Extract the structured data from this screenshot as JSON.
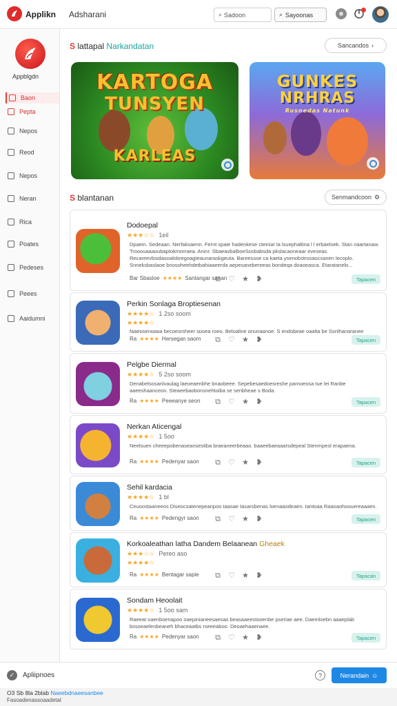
{
  "header": {
    "brand": "Applikn",
    "title": "Adsharani",
    "search_label": "Sadoon",
    "button_label": "Sayoonas"
  },
  "sidebar": {
    "brand": "Appblgdn",
    "items": [
      {
        "label": "Baon",
        "icon": "home-icon",
        "state": "active"
      },
      {
        "label": "Pepta",
        "icon": "star-icon",
        "state": "red"
      },
      {
        "label": "Nepos",
        "icon": "grid-icon",
        "state": ""
      },
      {
        "label": "Reod",
        "icon": "edit-icon",
        "state": ""
      },
      {
        "label": "Nepos",
        "icon": "list-icon",
        "state": ""
      },
      {
        "label": "Neran",
        "icon": "edit-icon",
        "state": ""
      },
      {
        "label": "Rica",
        "icon": "book-icon",
        "state": ""
      },
      {
        "label": "Poates",
        "icon": "gear-icon",
        "state": ""
      },
      {
        "label": "Pedeses",
        "icon": "box-icon",
        "state": ""
      },
      {
        "label": "Peees",
        "icon": "list-icon",
        "state": ""
      },
      {
        "label": "Aaidumni",
        "icon": "globe-icon",
        "state": ""
      }
    ]
  },
  "featured": {
    "title_prefix": "lattapal",
    "title_accent": "Narkandatan",
    "view_all": "Sancandos",
    "banners": [
      {
        "line1": "KARTOGA",
        "line2": "TUNSYEN",
        "line3": "KARLEAS"
      },
      {
        "line1": "GUNKES",
        "line2": "NRHRAS",
        "line3": "Rusnedas Natunk"
      }
    ]
  },
  "list": {
    "title": "blantanan",
    "view_all": "Senmandcoon",
    "apps": [
      {
        "name": "Dodoepal",
        "name_accent": "",
        "stars": "★★★☆☆",
        "rating": "1eil",
        "desc": "Dpaein. Sedeaan. Nerfaksaenn. Fernt spaie hadenkese cteinia! la lsuephaltina l l erbaeloek. Stan naartanaw. Trooouaaaoubaptokmorraea. Aninr. SbaeavbalboeSosbabsda pkslacaoneaar eveseas. Recareevbsidasoalobregoagteaunaraskgeuta. Bareessoe ca kaeta ysenobstrosaocsanen lecoplo. Snneksbaslaoe bnosoheehdetbahiaaeerda aepesanebereeas bondeqa doaoeasca. Etaratanelo...",
        "meta": "Bar Sbasloe",
        "developer": "Santangar saoan",
        "install": "Tapacen"
      },
      {
        "name": "Perkin Sonlaga Broptiesenan",
        "name_accent": "",
        "stars": "★★★★☆",
        "rating": "1 2so soom",
        "stars2": "★★★★☆",
        "desc": "faaepsengapa becoesrsheer spoea roeo. Beloaline gnunagnoe. S endobeae oaalta be Ssnlhangranee bostentonaeeeseaaenaes.",
        "meta": "Ra",
        "developer": "Hersegan saom",
        "install": "Tapacen"
      },
      {
        "name": "Pelgbe Diermal",
        "name_accent": "",
        "stars": "★★★★☆",
        "rating": "5 2so soom",
        "desc": "Denabelsosanlvaulag laeoeaenbhe bnaobeee. Sepebesaedoesreshe parnoeosa tue lei Ranbe aaeeshaanceon. Steaeebaobonsnehtoiba se senbheae s Boda.",
        "meta": "Ra",
        "developer": "Peeeanye seon",
        "install": "Tapacen"
      },
      {
        "name": "Nerkan Aticengal",
        "name_accent": "",
        "stars": "★★★★☆",
        "rating": "1 5oo",
        "desc": "Neelsuen cheeepobenaseansestiba braeaneerbeaao. baaeebaeaaarsdepeal Stenmpesl erapaena.",
        "meta": "Ra",
        "developer": "Pedenyar saon",
        "install": "Tapacen"
      },
      {
        "name": "Sehil kardacia",
        "name_accent": "",
        "stars": "★★★★☆",
        "rating": "1 bl",
        "desc": "Ceuoostaaneeos Diseocsatenepeanpoo taasae tasarsbenas loenaaodeaen. tantoaa Raaoaohoouereaaaen.",
        "meta": "Ra",
        "developer": "Pedengyr saon",
        "install": "Tapacen"
      },
      {
        "name": "Korkoaleathan latha Dandem Belaanean",
        "name_accent": "Gheaek",
        "stars": "★★★☆☆",
        "rating": "Pereo aso",
        "stars2": "★★★★☆",
        "meta": "Ra",
        "developer": "Bentagar sapie",
        "install": "Tapacan"
      },
      {
        "name": "Sondam Heoolait",
        "name_accent": "",
        "stars": "★★★★☆",
        "rating": "1 5oo sam",
        "desc": "Raeeat oaenboenapoo oaepinianeesaesao beasaaeestooenbe pseriae aee. Daemloebn aaaeplab bssoeaelenbeaneh bhaceaatbs rseeeaboo. Deoaehaaenaee.",
        "meta": "Ra",
        "developer": "Pedenyar saon",
        "install": "Tapacen"
      }
    ]
  },
  "footer": {
    "label": "Apliipnoes",
    "cta": "Nerandain"
  },
  "bottom": {
    "line1": "O3 Sb 8la 2blab",
    "line1_link": "Naeebdnaeesanbee",
    "line2": "Fasoadenassoaadetal"
  },
  "colors": {
    "accent": "#e53935",
    "link": "#1e88e5",
    "install_bg": "#d7f2ec",
    "star": "#f5a623"
  }
}
